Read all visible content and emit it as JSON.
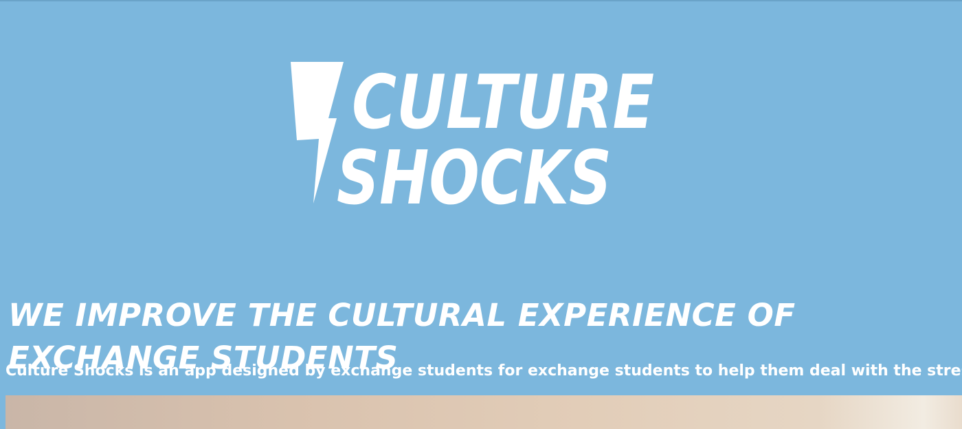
{
  "brand": {
    "logo_line1": "CULTURE",
    "logo_line2": "SHOCKS",
    "logo_icon": "lightning-bolt-icon",
    "background_color": "#7cb7dd",
    "text_color": "#ffffff"
  },
  "hero": {
    "headline": "WE IMPROVE THE CULTURAL EXPERIENCE OF EXCHANGE STUDENTS",
    "lede": "Culture Shocks is an app designed by exchange students for exchange students to help them deal with the stresses of"
  }
}
